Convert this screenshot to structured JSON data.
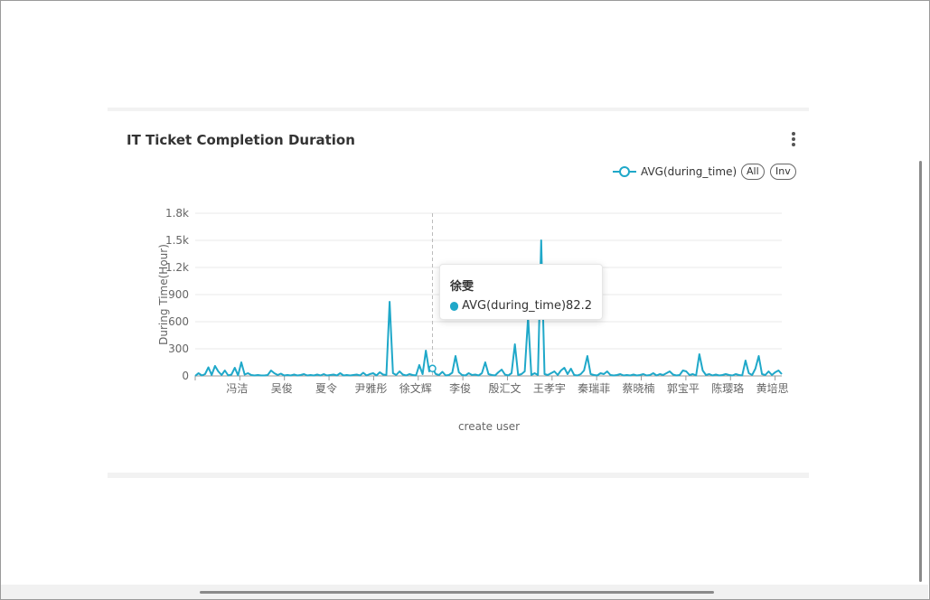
{
  "card": {
    "title": "IT Ticket Completion Duration"
  },
  "legend": {
    "series_label": "AVG(during_time)",
    "all_label": "All",
    "inv_label": "Inv"
  },
  "colors": {
    "series": "#1fa8c9",
    "grid": "#e8e8e8",
    "axis": "#999999"
  },
  "tooltip": {
    "title": "徐雯",
    "series": "AVG(during_time)",
    "value": "82.2"
  },
  "chart_data": {
    "type": "line",
    "xlabel": "create user",
    "ylabel": "During Time(Hour)",
    "ylim": [
      0,
      1800
    ],
    "yticks": [
      0,
      300,
      600,
      900,
      1200,
      1500,
      1800
    ],
    "ytick_labels": [
      "0",
      "300",
      "600",
      "900",
      "1.2k",
      "1.5k",
      "1.8k"
    ],
    "tick_categories": [
      "冯洁",
      "吴俊",
      "夏令",
      "尹雅彤",
      "徐文辉",
      "李俊",
      "殷汇文",
      "王孝宇",
      "秦瑞菲",
      "蔡晓楠",
      "郭宝平",
      "陈璎珞",
      "黄培思"
    ],
    "grid": true,
    "legend_position": "top-right",
    "highlighted_category": "徐雯",
    "series": [
      {
        "name": "AVG(during_time)",
        "values": [
          0,
          30,
          5,
          20,
          95,
          10,
          110,
          50,
          10,
          60,
          5,
          15,
          90,
          5,
          150,
          15,
          30,
          10,
          5,
          10,
          5,
          5,
          10,
          60,
          30,
          10,
          25,
          5,
          10,
          5,
          15,
          5,
          10,
          20,
          5,
          10,
          5,
          15,
          5,
          20,
          5,
          10,
          15,
          5,
          30,
          5,
          10,
          5,
          10,
          15,
          5,
          35,
          5,
          20,
          30,
          5,
          40,
          15,
          10,
          820,
          30,
          10,
          50,
          15,
          5,
          20,
          10,
          5,
          120,
          20,
          280,
          50,
          82,
          20,
          10,
          45,
          5,
          10,
          35,
          220,
          40,
          10,
          5,
          30,
          10,
          15,
          5,
          30,
          150,
          20,
          10,
          5,
          40,
          70,
          15,
          5,
          30,
          350,
          10,
          20,
          50,
          650,
          10,
          30,
          10,
          1500,
          20,
          10,
          30,
          50,
          10,
          60,
          90,
          20,
          80,
          10,
          5,
          20,
          60,
          220,
          20,
          10,
          5,
          30,
          20,
          50,
          10,
          5,
          10,
          20,
          5,
          10,
          5,
          15,
          5,
          10,
          20,
          5,
          10,
          30,
          5,
          20,
          10,
          30,
          50,
          15,
          5,
          10,
          60,
          50,
          10,
          20,
          5,
          240,
          60,
          10,
          20,
          5,
          15,
          5,
          10,
          20,
          10,
          5,
          20,
          10,
          5,
          170,
          30,
          10,
          80,
          220,
          20,
          10,
          50,
          10,
          40,
          60,
          20
        ]
      }
    ]
  }
}
